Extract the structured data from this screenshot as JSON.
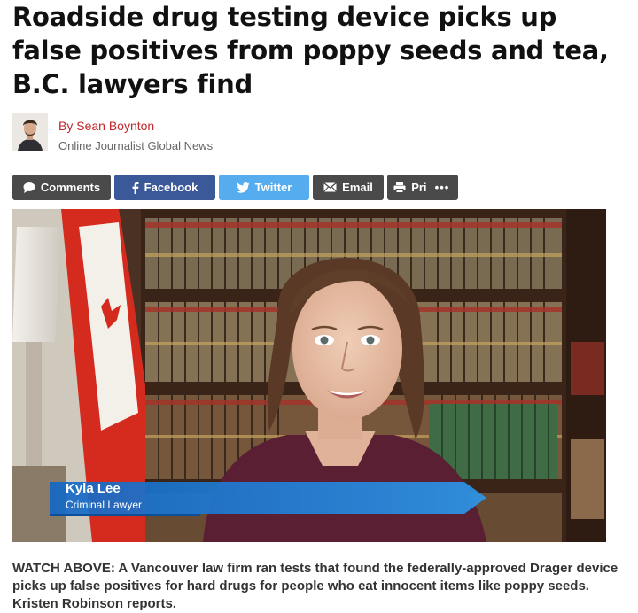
{
  "article": {
    "headline": "Roadside drug testing device picks up false positives from poppy seeds and tea, B.C. lawyers find",
    "author": "By Sean Boynton",
    "author_role": "Online Journalist  Global News"
  },
  "share": {
    "comments": "Comments",
    "facebook": "Facebook",
    "twitter": "Twitter",
    "email": "Email",
    "print": "Print",
    "more": "•••",
    "colors": {
      "comments": "#4a4a4a",
      "facebook": "#3b5998",
      "twitter": "#55acee",
      "email": "#4a4a4a",
      "print": "#4a4a4a",
      "more": "#4a4a4a"
    }
  },
  "video": {
    "lower_third_name": "Kyla Lee",
    "lower_third_title": "Criminal Lawyer",
    "lower_third_color": "#1f7fd6"
  },
  "caption": "WATCH ABOVE: A Vancouver law firm ran tests that found the federally-approved Drager device picks up false positives for hard drugs for people who eat innocent items like poppy seeds. Kristen Robinson reports."
}
